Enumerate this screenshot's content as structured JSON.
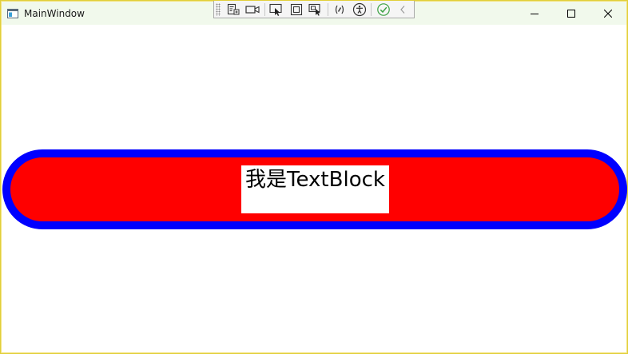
{
  "window": {
    "title": "MainWindow",
    "border_color": "#e1cf3a",
    "titlebar_color": "#f1f9ec"
  },
  "debug_toolbar": {
    "buttons": [
      {
        "icon": "go-to-live-visual-tree-icon"
      },
      {
        "icon": "video-camera-icon"
      },
      {
        "icon": "select-element-icon"
      },
      {
        "icon": "display-layout-adorners-icon"
      },
      {
        "icon": "track-focused-element-icon"
      },
      {
        "icon": "binding-failures-icon"
      },
      {
        "icon": "accessibility-icon"
      },
      {
        "icon": "checkmark-icon"
      },
      {
        "icon": "collapse-chevron-icon"
      }
    ]
  },
  "content": {
    "text_block": "我是TextBlock",
    "border_color": "#0000ff",
    "fill_color": "#ff0000",
    "text_background": "#ffffff"
  }
}
